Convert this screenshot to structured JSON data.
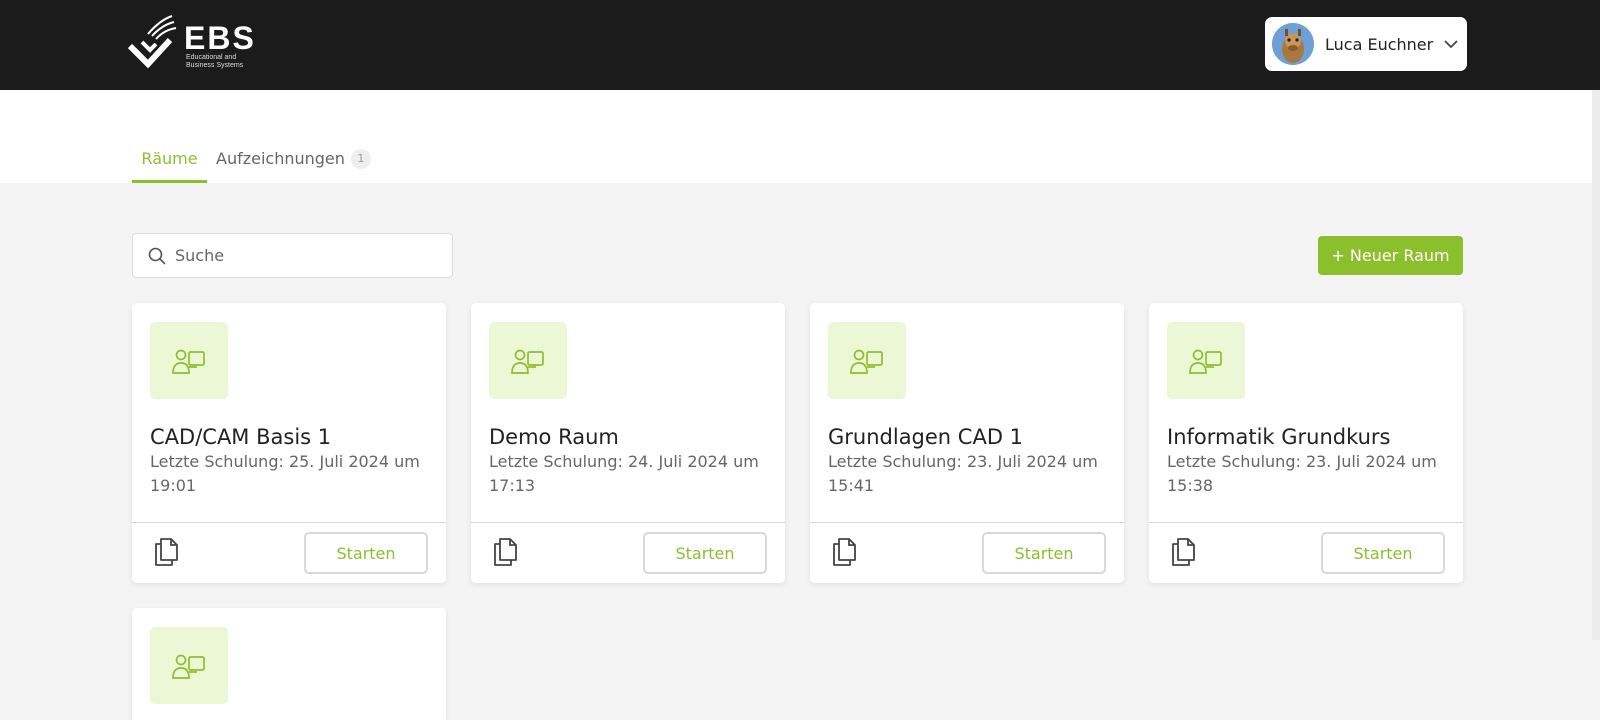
{
  "header": {
    "logo_text": "EBS",
    "logo_subtitle": "Educational and Business Systems",
    "user_name": "Luca Euchner"
  },
  "tabs": [
    {
      "label": "Räume"
    },
    {
      "label": "Aufzeichnungen",
      "badge": "1"
    }
  ],
  "toolbar": {
    "search_placeholder": "Suche",
    "new_room_label": "+ Neuer Raum"
  },
  "rooms": [
    {
      "title": "CAD/CAM Basis 1",
      "last_session": "Letzte Schulung: 25. Juli 2024 um 19:01",
      "start_label": "Starten"
    },
    {
      "title": "Demo Raum",
      "last_session": "Letzte Schulung: 24. Juli 2024 um 17:13",
      "start_label": "Starten"
    },
    {
      "title": "Grundlagen CAD 1",
      "last_session": "Letzte Schulung: 23. Juli 2024 um 15:41",
      "start_label": "Starten"
    },
    {
      "title": "Informatik Grundkurs",
      "last_session": "Letzte Schulung: 23. Juli 2024 um 15:38",
      "start_label": "Starten"
    }
  ],
  "colors": {
    "accent": "#8cbf2c",
    "accent_light": "#ecf7d6",
    "header_bg": "#1b1b1b",
    "page_bg": "#f4f4f4"
  },
  "icons": {
    "room": "classroom-icon",
    "copy": "copy-icon",
    "search": "search-icon",
    "dropdown": "chevron-down-icon"
  }
}
